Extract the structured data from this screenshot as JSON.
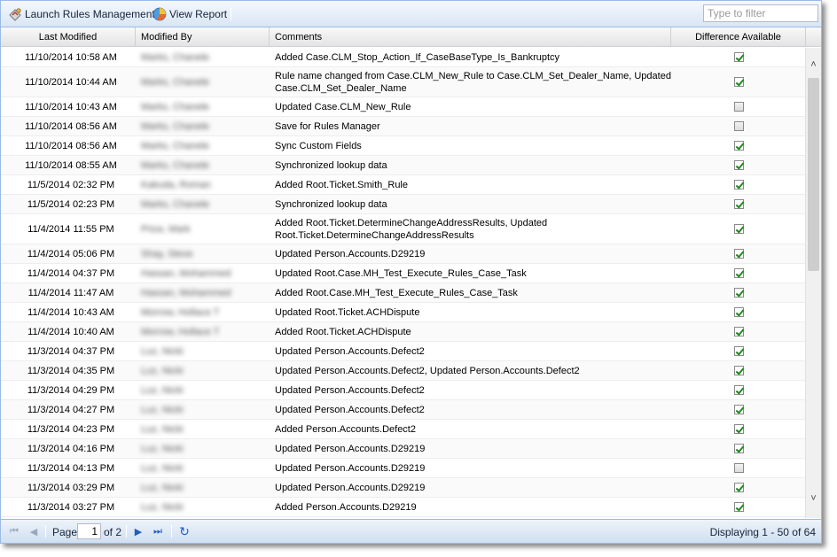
{
  "toolbar": {
    "launch_label": "Launch Rules Management",
    "view_report_label": "View Report",
    "filter_placeholder": "Type to filter"
  },
  "columns": {
    "last_modified": "Last Modified",
    "modified_by": "Modified By",
    "comments": "Comments",
    "difference": "Difference Available"
  },
  "rows": [
    {
      "date": "11/10/2014 10:58 AM",
      "by": "Marks, Chanele",
      "comment": "Added Case.CLM_Stop_Action_If_CaseBaseType_Is_Bankruptcy",
      "diff": true
    },
    {
      "date": "11/10/2014 10:44 AM",
      "by": "Marks, Chanele",
      "comment": "Rule name changed from Case.CLM_New_Rule to Case.CLM_Set_Dealer_Name, Updated Case.CLM_Set_Dealer_Name",
      "diff": true
    },
    {
      "date": "11/10/2014 10:43 AM",
      "by": "Marks, Chanele",
      "comment": "Updated Case.CLM_New_Rule",
      "diff": false
    },
    {
      "date": "11/10/2014 08:56 AM",
      "by": "Marks, Chanele",
      "comment": "Save for Rules Manager",
      "diff": false
    },
    {
      "date": "11/10/2014 08:56 AM",
      "by": "Marks, Chanele",
      "comment": "Sync Custom Fields",
      "diff": true
    },
    {
      "date": "11/10/2014 08:55 AM",
      "by": "Marks, Chanele",
      "comment": "Synchronized lookup data",
      "diff": true
    },
    {
      "date": "11/5/2014 02:32 PM",
      "by": "Kakuda, Roman",
      "comment": "Added Root.Ticket.Smith_Rule",
      "diff": true
    },
    {
      "date": "11/5/2014 02:23 PM",
      "by": "Marks, Chanele",
      "comment": "Synchronized lookup data",
      "diff": true
    },
    {
      "date": "11/4/2014 11:55 PM",
      "by": "Price, Mark",
      "comment": "Added Root.Ticket.DetermineChangeAddressResults, Updated Root.Ticket.DetermineChangeAddressResults",
      "diff": true
    },
    {
      "date": "11/4/2014 05:06 PM",
      "by": "Shay, Steve",
      "comment": "Updated Person.Accounts.D29219",
      "diff": true
    },
    {
      "date": "11/4/2014 04:37 PM",
      "by": "Hassan, Mohammed",
      "comment": "Updated Root.Case.MH_Test_Execute_Rules_Case_Task",
      "diff": true
    },
    {
      "date": "11/4/2014 11:47 AM",
      "by": "Hassan, Mohammed",
      "comment": "Added Root.Case.MH_Test_Execute_Rules_Case_Task",
      "diff": true
    },
    {
      "date": "11/4/2014 10:43 AM",
      "by": "Morrow, Hollace T",
      "comment": "Updated Root.Ticket.ACHDispute",
      "diff": true
    },
    {
      "date": "11/4/2014 10:40 AM",
      "by": "Morrow, Hollace T",
      "comment": "Added Root.Ticket.ACHDispute",
      "diff": true
    },
    {
      "date": "11/3/2014 04:37 PM",
      "by": "Luz, Nicki",
      "comment": "Updated Person.Accounts.Defect2",
      "diff": true
    },
    {
      "date": "11/3/2014 04:35 PM",
      "by": "Luz, Nicki",
      "comment": "Updated Person.Accounts.Defect2, Updated Person.Accounts.Defect2",
      "diff": true
    },
    {
      "date": "11/3/2014 04:29 PM",
      "by": "Luz, Nicki",
      "comment": "Updated Person.Accounts.Defect2",
      "diff": true
    },
    {
      "date": "11/3/2014 04:27 PM",
      "by": "Luz, Nicki",
      "comment": "Updated Person.Accounts.Defect2",
      "diff": true
    },
    {
      "date": "11/3/2014 04:23 PM",
      "by": "Luz, Nicki",
      "comment": "Added Person.Accounts.Defect2",
      "diff": true
    },
    {
      "date": "11/3/2014 04:16 PM",
      "by": "Luz, Nicki",
      "comment": "Updated Person.Accounts.D29219",
      "diff": true
    },
    {
      "date": "11/3/2014 04:13 PM",
      "by": "Luz, Nicki",
      "comment": "Updated Person.Accounts.D29219",
      "diff": false
    },
    {
      "date": "11/3/2014 03:29 PM",
      "by": "Luz, Nicki",
      "comment": "Updated Person.Accounts.D29219",
      "diff": true
    },
    {
      "date": "11/3/2014 03:27 PM",
      "by": "Luz, Nicki",
      "comment": "Added Person.Accounts.D29219",
      "diff": true
    }
  ],
  "pager": {
    "page_label": "Page",
    "page_value": "1",
    "of_label": "of 2",
    "display_text": "Displaying 1 - 50 of 64"
  }
}
